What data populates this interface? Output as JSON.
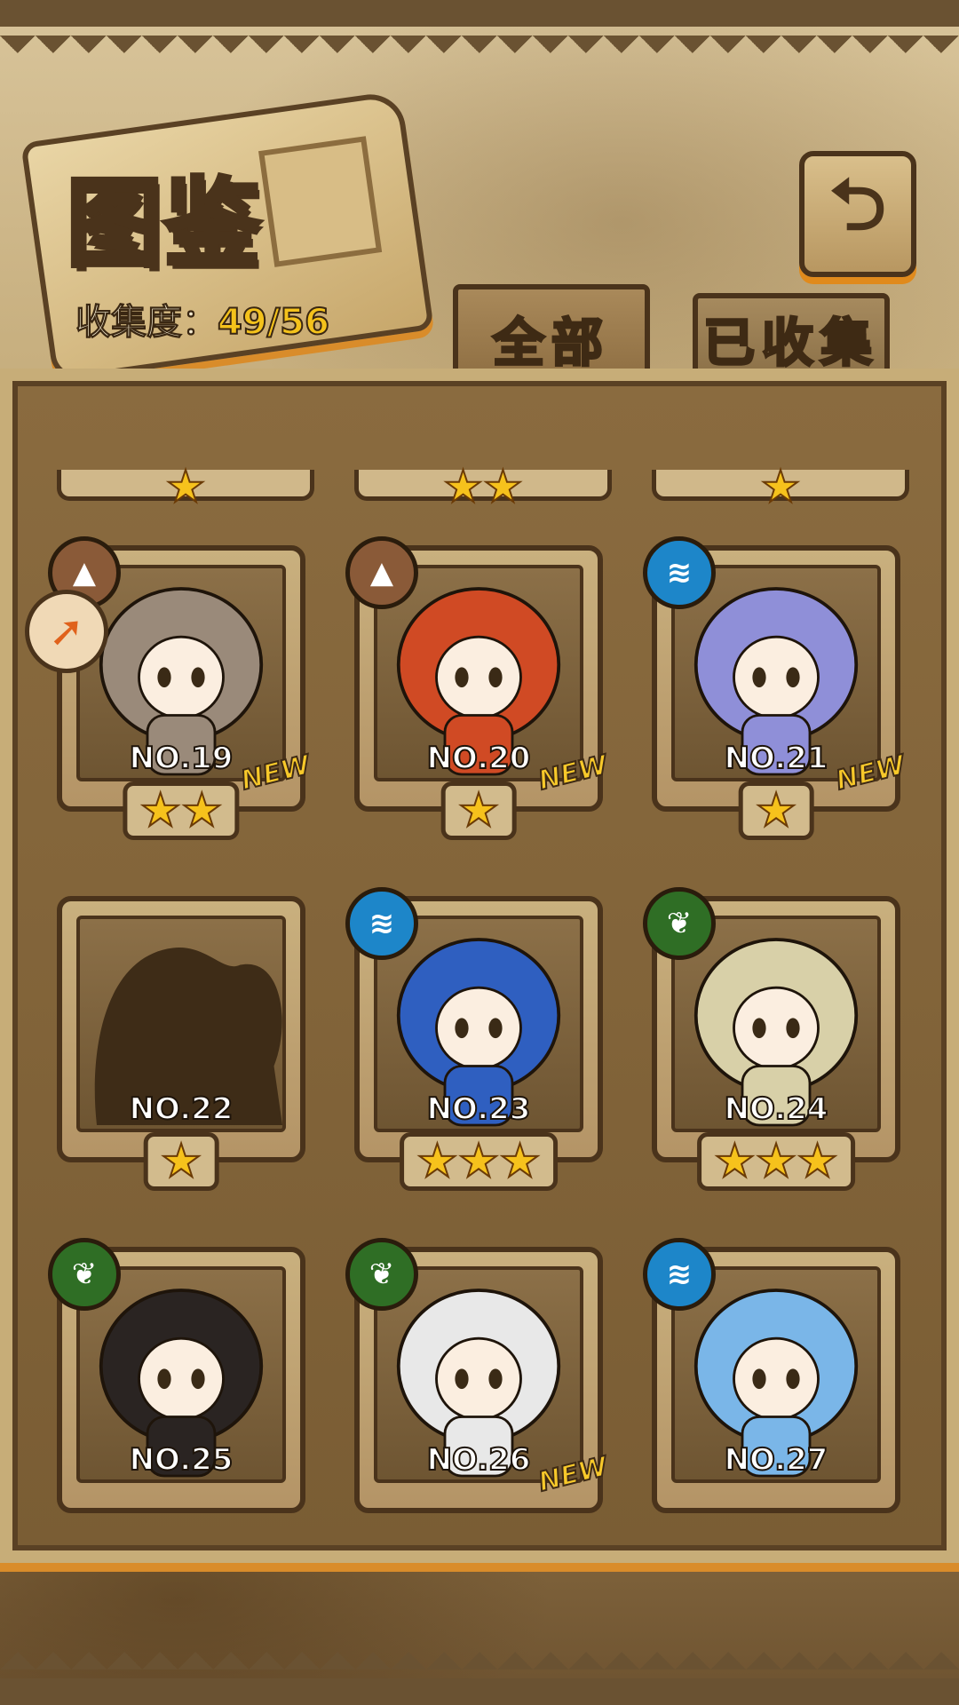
{
  "header": {
    "title": "图鉴",
    "collection_label": "收集度：",
    "collection_count": "49/56",
    "back_icon": "return-arrow-icon"
  },
  "tabs": [
    {
      "label": "全部",
      "active": true
    },
    {
      "label": "已收集",
      "active": false
    }
  ],
  "partial_row": [
    {
      "stars": "★"
    },
    {
      "stars": "★★"
    },
    {
      "stars": "★"
    }
  ],
  "cards": [
    {
      "no": "NO.19",
      "element": "earth",
      "new": "NEW",
      "stars": "★★",
      "color": "#9a8a7a"
    },
    {
      "no": "NO.20",
      "element": "earth",
      "new": "NEW",
      "stars": "★",
      "color": "#d04a24"
    },
    {
      "no": "NO.21",
      "element": "water",
      "new": "NEW",
      "stars": "★",
      "color": "#8f8fd8"
    },
    {
      "no": "NO.22",
      "element": "",
      "new": "",
      "stars": "★",
      "color": "#3e2c17"
    },
    {
      "no": "NO.23",
      "element": "water",
      "new": "",
      "stars": "★★★",
      "color": "#2f5fc0"
    },
    {
      "no": "NO.24",
      "element": "wood",
      "new": "",
      "stars": "★★★",
      "color": "#d8d0a8"
    },
    {
      "no": "NO.25",
      "element": "wood",
      "new": "",
      "stars": "",
      "color": "#2a2422"
    },
    {
      "no": "NO.26",
      "element": "wood",
      "new": "NEW",
      "stars": "",
      "color": "#e8e8e8"
    },
    {
      "no": "NO.27",
      "element": "water",
      "new": "",
      "stars": "",
      "color": "#7ab6e8"
    }
  ],
  "colors": {
    "star": "#f6c21c",
    "accent_orange": "#d98c2a",
    "earth": "#8a5a38",
    "water": "#1d86c9",
    "wood": "#2f6e25"
  }
}
